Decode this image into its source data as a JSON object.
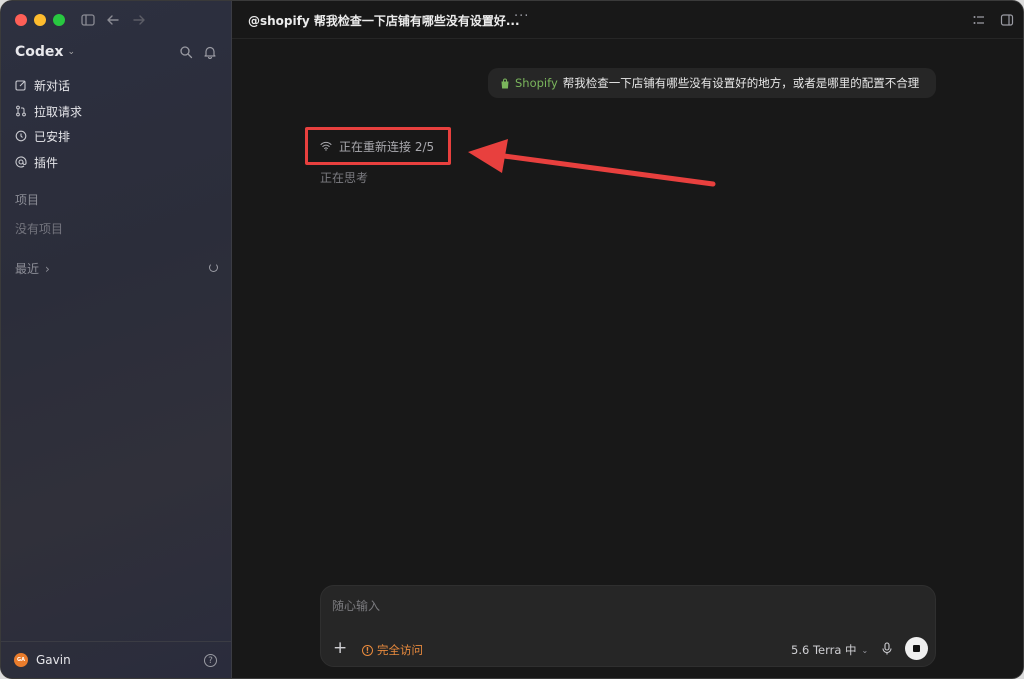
{
  "sidebar": {
    "brand": "Codex",
    "items": [
      {
        "label": "新对话",
        "icon": "compose-icon"
      },
      {
        "label": "拉取请求",
        "icon": "pull-request-icon"
      },
      {
        "label": "已安排",
        "icon": "clock-icon"
      },
      {
        "label": "插件",
        "icon": "at-icon"
      }
    ],
    "projects_label": "项目",
    "no_projects": "没有项目",
    "recent_label": "最近",
    "user": {
      "name": "Gavin",
      "initials": "GA"
    }
  },
  "header": {
    "title": "@shopify 帮我检查一下店铺有哪些没有设置好...",
    "more": "···"
  },
  "conversation": {
    "user_message": {
      "mention": "Shopify",
      "text": "帮我检查一下店铺有哪些没有设置好的地方，或者是哪里的配置不合理"
    },
    "status": "正在重新连接 2/5",
    "thinking": "正在思考"
  },
  "composer": {
    "placeholder": "随心输入",
    "access_label": "完全访问",
    "model_label": "5.6 Terra 中"
  },
  "colors": {
    "annotation_red": "#e8403e",
    "access_orange": "#e88a3d",
    "shopify_green": "#7ab55c"
  }
}
